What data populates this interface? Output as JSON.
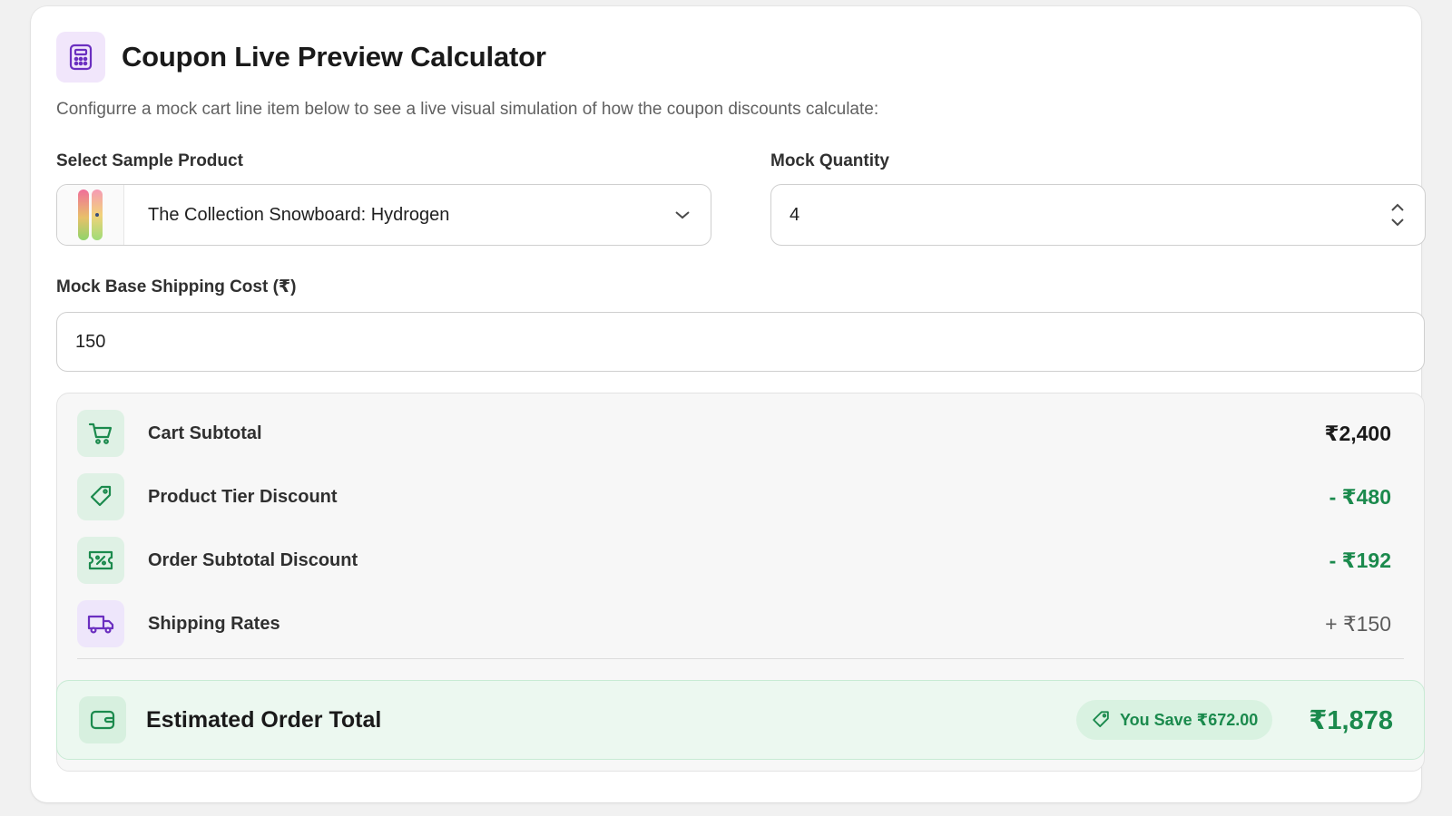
{
  "header": {
    "title": "Coupon Live Preview Calculator",
    "description": "Configurre a mock cart line item below to see a live visual simulation of how the coupon discounts calculate:",
    "icon": "calculator-icon"
  },
  "form": {
    "product_label": "Select Sample Product",
    "product_value": "The Collection Snowboard: Hydrogen",
    "quantity_label": "Mock Quantity",
    "quantity_value": "4",
    "shipping_label": "Mock Base Shipping Cost (₹)",
    "shipping_value": "150"
  },
  "summary": {
    "rows": [
      {
        "label": "Cart Subtotal",
        "value": "₹2,400",
        "icon": "cart-icon"
      },
      {
        "label": "Product Tier Discount",
        "value": "- ₹480",
        "icon": "tag-icon"
      },
      {
        "label": "Order Subtotal Discount",
        "value": "- ₹192",
        "icon": "discount-ticket-icon"
      },
      {
        "label": "Shipping Rates",
        "value": "+ ₹150",
        "icon": "truck-icon"
      }
    ],
    "total_label": "Estimated Order Total",
    "savings": "You Save ₹672.00",
    "total_value": "₹1,878"
  },
  "colors": {
    "accent_green": "#1b8a4d",
    "accent_purple": "#6b2fc0",
    "total_background": "#ecf8f0"
  }
}
